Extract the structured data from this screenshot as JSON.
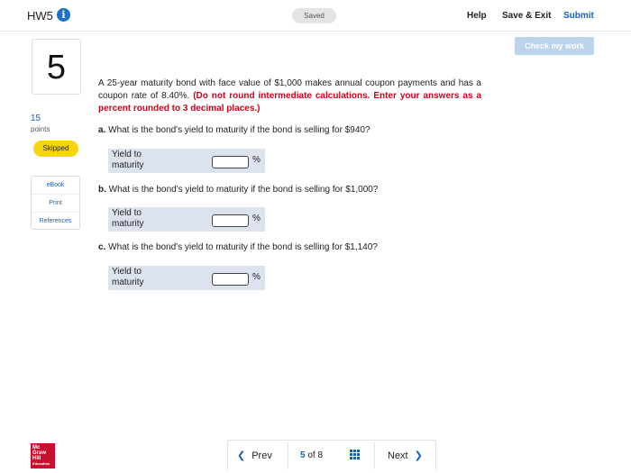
{
  "header": {
    "title": "HW5",
    "info_glyph": "i",
    "saved_status": "Saved",
    "help": "Help",
    "save_exit": "Save & Exit",
    "submit": "Submit"
  },
  "check_my_work": "Check my work",
  "question_panel": {
    "number": "5",
    "points_value": "15",
    "points_label": "points",
    "status": "Skipped",
    "resources": [
      "eBook",
      "Print",
      "References"
    ]
  },
  "problem": {
    "text": "A 25-year maturity bond with face value of $1,000 makes annual coupon payments and has a coupon rate of 8.40%.",
    "instruction": "(Do not round intermediate calculations. Enter your answers as a percent rounded to 3 decimal places.)"
  },
  "parts": [
    {
      "letter": "a.",
      "question": "What is the bond's yield to maturity if the bond is selling for $940?",
      "label": "Yield to maturity",
      "value": "",
      "unit": "%"
    },
    {
      "letter": "b.",
      "question": "What is the bond's yield to maturity if the bond is selling for $1,000?",
      "label": "Yield to maturity",
      "value": "",
      "unit": "%"
    },
    {
      "letter": "c.",
      "question": "What is the bond's yield to maturity if the bond is selling for $1,140?",
      "label": "Yield to maturity",
      "value": "",
      "unit": "%"
    }
  ],
  "footer": {
    "logo_lines": [
      "Mc",
      "Graw",
      "Hill",
      "Education"
    ],
    "prev": "Prev",
    "current_page": "5",
    "of_label": "of",
    "total_pages": "8",
    "next": "Next"
  },
  "colors": {
    "accent": "#1a5fb4",
    "warning_text": "#d0021b",
    "skipped_badge": "#f5d50f",
    "answer_row_bg": "#dde3ee",
    "logo_red": "#c8102e"
  },
  "icons": {
    "info": "info-icon",
    "prev": "chevron-left-icon",
    "next": "chevron-right-icon",
    "grid": "grid-icon"
  }
}
